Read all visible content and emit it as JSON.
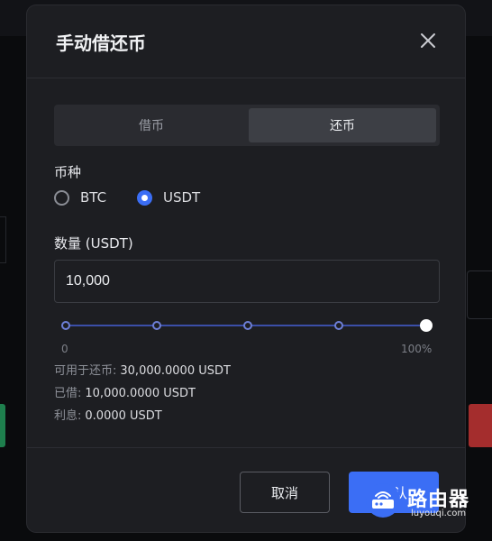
{
  "modal": {
    "title": "手动借还币"
  },
  "tabs": [
    {
      "label": "借币",
      "active": false
    },
    {
      "label": "还币",
      "active": true
    }
  ],
  "currency": {
    "label": "币种",
    "options": [
      {
        "label": "BTC",
        "checked": false
      },
      {
        "label": "USDT",
        "checked": true
      }
    ]
  },
  "amount": {
    "label": "数量 (USDT)",
    "value": "10,000"
  },
  "slider": {
    "min_label": "0",
    "max_label": "100%",
    "value_fraction": 1.0,
    "steps": [
      0,
      0.25,
      0.5,
      0.75,
      1.0
    ]
  },
  "info": {
    "available_label": "可用于还币:",
    "available_value": "30,000.0000 USDT",
    "borrowed_label": "已借:",
    "borrowed_value": "10,000.0000 USDT",
    "interest_label": "利息:",
    "interest_value": "0.0000 USDT"
  },
  "footer": {
    "cancel_label": "取消",
    "confirm_label": "确认"
  },
  "watermark": {
    "brand": "路由器",
    "url": "luyouqi.com"
  },
  "colors": {
    "accent": "#3b6ef5",
    "modal_bg": "#1d1e22",
    "page_bg": "#0b0c0e"
  }
}
